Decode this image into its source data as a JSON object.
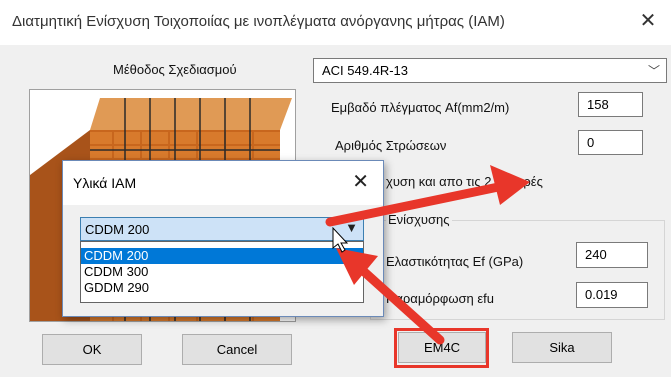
{
  "window": {
    "title": "Διατμητική Ενίσχυση Τοιχοποιίας με ινοπλέγματα ανόργανης μήτρας (IAM)",
    "close_glyph": "✕"
  },
  "form": {
    "method_label": "Μέθοδος Σχεδιασμού",
    "method_value": "ACI 549.4R-13",
    "area_label": "Εμβαδό πλέγματος Af(mm2/m)",
    "area_value": "158",
    "layers_label": "Αριθμός Στρώσεων",
    "layers_value": "0",
    "both_sides_label_partial": "χυση και απο τις 2 πλευρές",
    "group_label_partial": "Ενίσχυσης",
    "modulus_label_partial": "Ελαστικότητας Ef (GPa)",
    "modulus_value": "240",
    "strain_label_partial": "Παραμόρφωση εfu",
    "strain_value": "0.019"
  },
  "buttons": {
    "ok": "OK",
    "cancel": "Cancel",
    "em4c_partial": "EM4C",
    "sika": "Sika"
  },
  "popup": {
    "title": "Υλικά IAM",
    "close_glyph": "✕",
    "selected_value": "CDDM 200",
    "options": [
      "CDDM 200",
      "CDDM 300",
      "GDDM 290"
    ],
    "highlighted_index": 0
  },
  "colors": {
    "selection": "#0078d7",
    "arrow": "#e8362a",
    "brick": "#c8661d"
  }
}
